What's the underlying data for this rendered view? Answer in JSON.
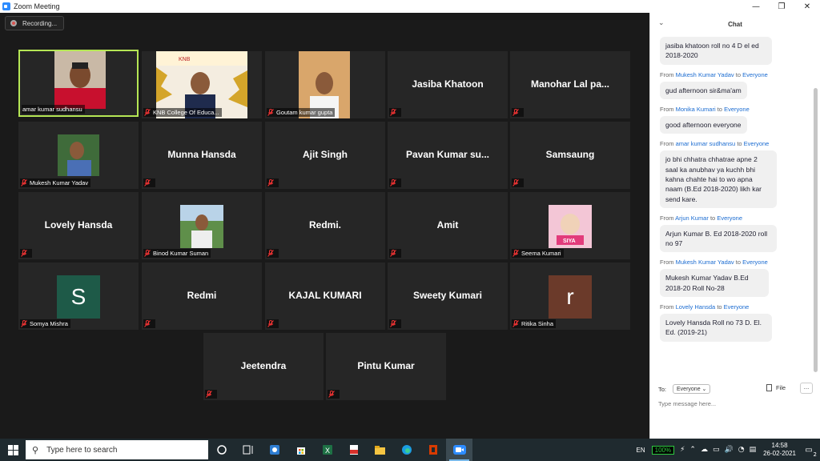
{
  "window": {
    "title": "Zoom Meeting",
    "minimize": "—",
    "maximize": "❐",
    "close": "✕"
  },
  "recording": {
    "label": "Recording..."
  },
  "participants": [
    {
      "display": "photo",
      "label": "amar kumar sudhansu",
      "active": true
    },
    {
      "display": "photo",
      "label": "KNB College Of Educa..."
    },
    {
      "display": "photo",
      "label": "Goutam kumar gupta"
    },
    {
      "display": "name",
      "name": "Jasiba Khatoon"
    },
    {
      "display": "name",
      "name": "Manohar Lal pa..."
    },
    {
      "display": "photo",
      "label": "Mukesh Kumar Yadav"
    },
    {
      "display": "name",
      "name": "Munna Hansda"
    },
    {
      "display": "name",
      "name": "Ajit Singh"
    },
    {
      "display": "name",
      "name": "Pavan Kumar su..."
    },
    {
      "display": "name",
      "name": "Samsaung"
    },
    {
      "display": "name",
      "name": "Lovely Hansda"
    },
    {
      "display": "photo",
      "label": "Binod Kumar Suman"
    },
    {
      "display": "name",
      "name": "Redmi."
    },
    {
      "display": "name",
      "name": "Amit"
    },
    {
      "display": "photo",
      "label": "Seema Kumari",
      "photo_text": "SIYA"
    },
    {
      "display": "avatar",
      "letter": "S",
      "label": "Somya Mishra",
      "color": "#1e5a48"
    },
    {
      "display": "name",
      "name": "Redmi"
    },
    {
      "display": "name",
      "name": "KAJAL KUMARI"
    },
    {
      "display": "name",
      "name": "Sweety Kumari"
    },
    {
      "display": "avatar",
      "letter": "r",
      "label": "Ritika Sinha",
      "color": "#6b3a2a"
    },
    {
      "display": "name",
      "name": "Jeetendra"
    },
    {
      "display": "name",
      "name": "Pintu Kumar"
    }
  ],
  "chat": {
    "title": "Chat",
    "messages": [
      {
        "from": "",
        "to": "",
        "text": "jasiba khatoon roll no 4 D el ed 2018-2020"
      },
      {
        "from": "Mukesh Kumar Yadav",
        "to": "Everyone",
        "text": "gud afternoon sir&ma'am"
      },
      {
        "from": "Monika Kumari",
        "to": "Everyone",
        "text": "good afternoon everyone"
      },
      {
        "from": "amar kumar sudhansu",
        "to": "Everyone",
        "text": "jo bhi chhatra chhatrae apne 2 saal ka anubhav ya kuchh bhi kahna chahte hai to wo apna naam  (B.Ed 2018-2020) likh kar send kare."
      },
      {
        "from": "Arjun Kumar",
        "to": "Everyone",
        "text": "Arjun Kumar B. Ed 2018-2020 roll no 97"
      },
      {
        "from": "Mukesh Kumar Yadav",
        "to": "Everyone",
        "text": "Mukesh Kumar Yadav B.Ed 2018-20 Roll No-28"
      },
      {
        "from": "Lovely Hansda",
        "to": "Everyone",
        "text": "Lovely Hansda Roll no 73 D. El. Ed. (2019-21)"
      }
    ],
    "from_word": "From",
    "to_word": "to",
    "to_label": "To:",
    "to_value": "Everyone",
    "file_label": "File",
    "more_label": "...",
    "input_placeholder": "Type message here..."
  },
  "taskbar": {
    "search_placeholder": "Type here to search",
    "language": "EN",
    "battery": "100%",
    "time": "14:58",
    "date": "26-02-2021",
    "notifications": "2"
  }
}
